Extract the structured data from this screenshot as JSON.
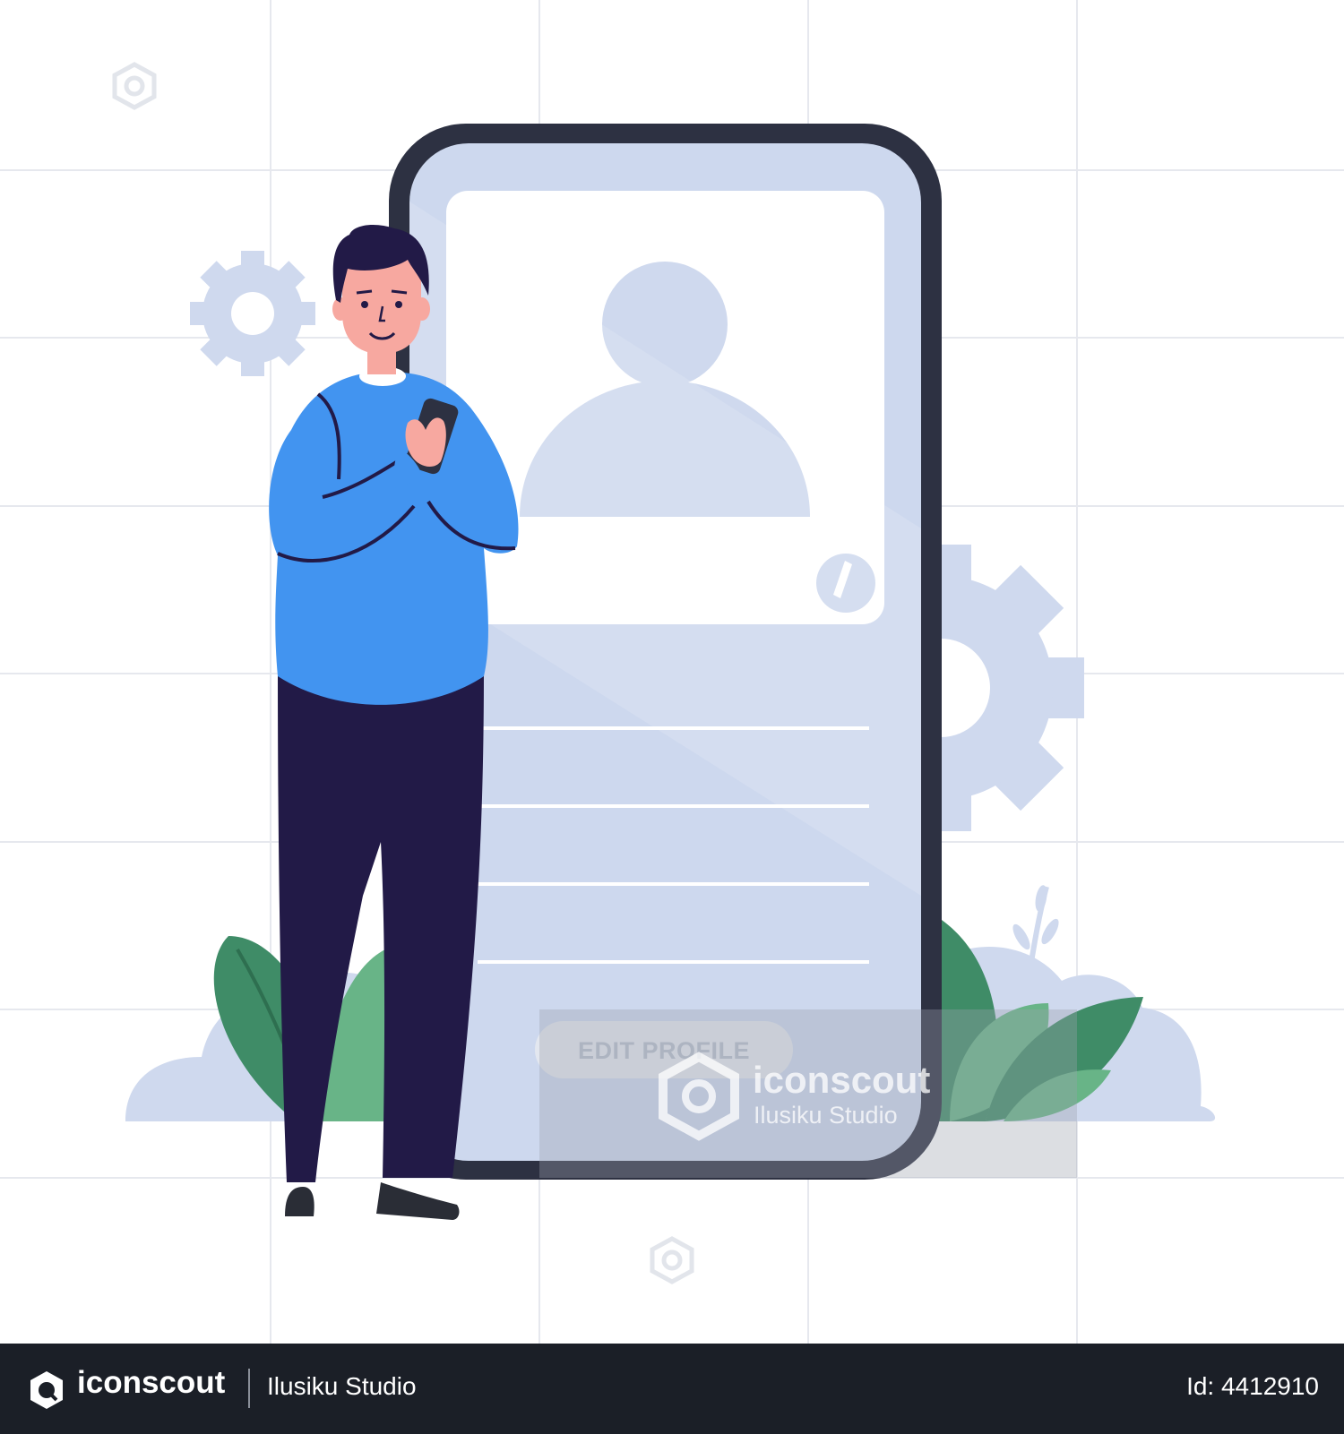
{
  "phone": {
    "button_label": "EDIT PROFILE"
  },
  "watermark": {
    "brand": "iconscout",
    "author": "Ilusiku Studio"
  },
  "footer": {
    "brand": "iconscout",
    "author": "Ilusiku Studio",
    "asset_id": "Id: 4412910"
  },
  "colors": {
    "background": "#ffffff",
    "phone_frame": "#2d3142",
    "phone_screen": "#cdd8ee",
    "gear": "#cfd9ee",
    "sweater": "#4294f0",
    "pants": "#221a47",
    "skin": "#f7a8a0",
    "leaf_dark": "#3f8c67",
    "leaf_light": "#68b487",
    "footer_bg": "#1b1f27"
  }
}
